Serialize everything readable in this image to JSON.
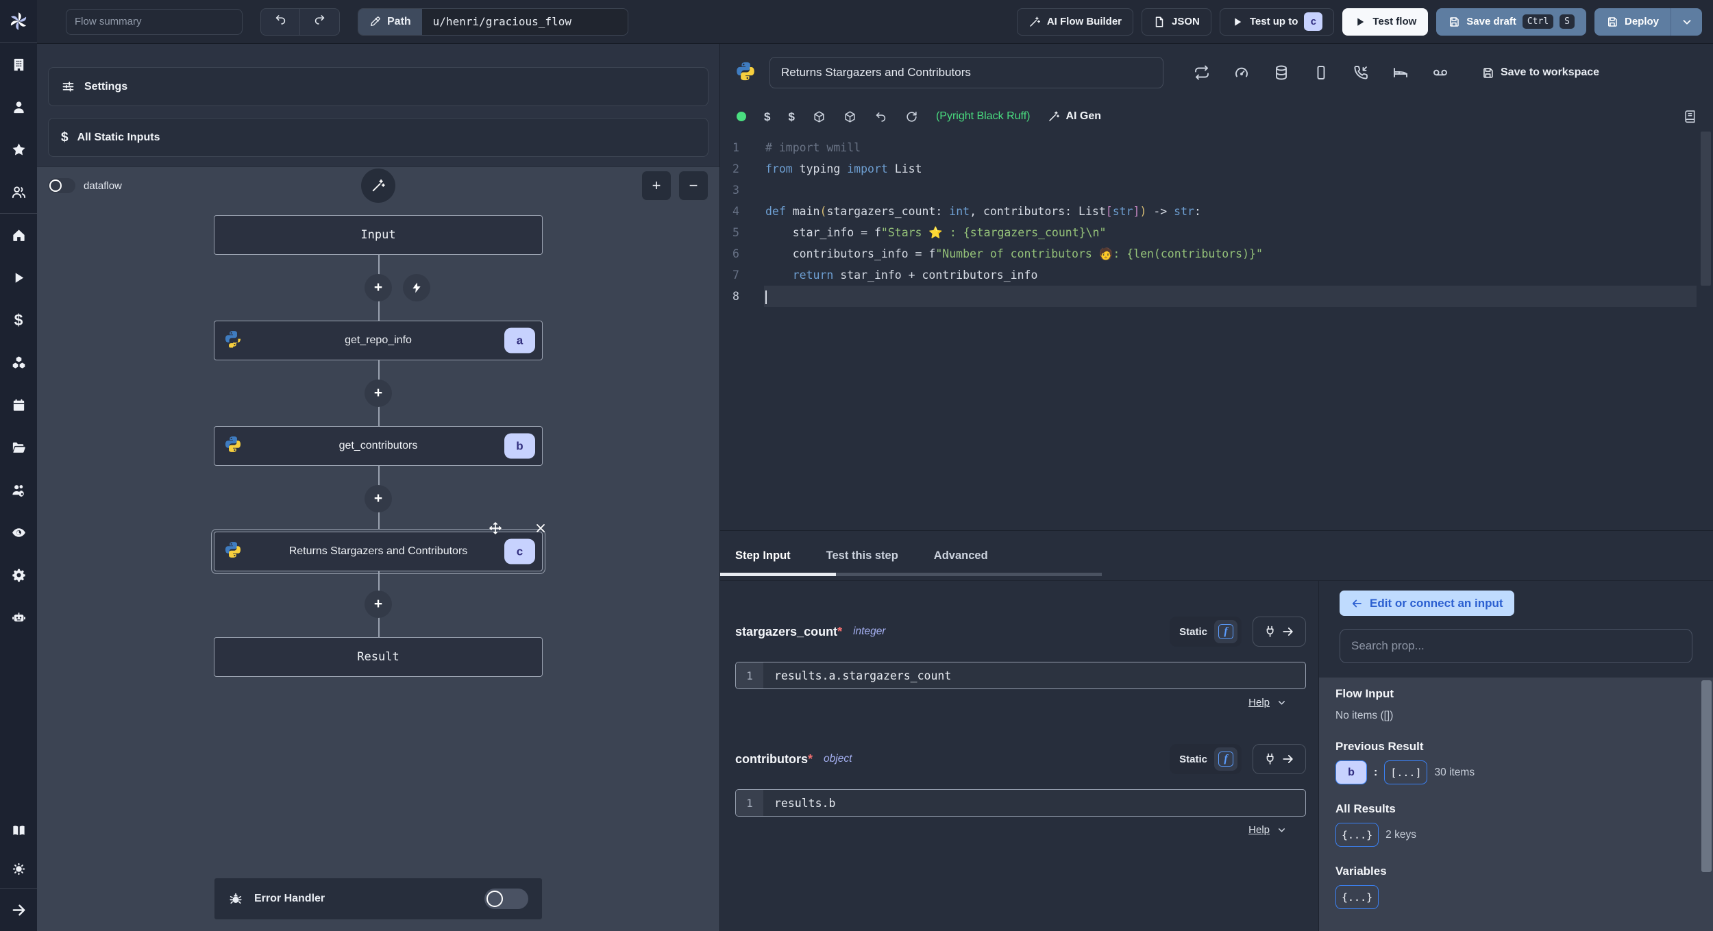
{
  "topbar": {
    "flow_summary_placeholder": "Flow summary",
    "path_label": "Path",
    "path_value": "u/henri/gracious_flow",
    "ai_flow_builder": "AI Flow Builder",
    "json_button": "JSON",
    "test_up_to": "Test up to",
    "test_up_to_badge": "c",
    "test_flow": "Test flow",
    "save_draft": "Save draft",
    "save_draft_keys": [
      "Ctrl",
      "S"
    ],
    "deploy": "Deploy"
  },
  "sidebar": {
    "icons": [
      "windmill-logo",
      "building",
      "user",
      "star",
      "users",
      "home",
      "play",
      "dollar",
      "boxes",
      "calendar",
      "folder-open",
      "users-cog",
      "eye",
      "gear",
      "robot",
      "book",
      "sun-theme",
      "arrow-right"
    ]
  },
  "flow_panel": {
    "settings": "Settings",
    "all_static_inputs": "All Static Inputs",
    "dataflow_label": "dataflow",
    "graph": {
      "input_node": "Input",
      "steps": [
        {
          "label": "get_repo_info",
          "badge": "a",
          "language": "python"
        },
        {
          "label": "get_contributors",
          "badge": "b",
          "language": "python"
        },
        {
          "label": "Returns Stargazers and Contributors",
          "badge": "c",
          "language": "python",
          "selected": true
        }
      ],
      "result_node": "Result"
    },
    "error_handler": "Error Handler",
    "error_handler_enabled": false
  },
  "editor": {
    "title": "Returns Stargazers and Contributors",
    "save_to_workspace": "Save to workspace",
    "header_icons": [
      "repeat",
      "gauge",
      "database",
      "rectangle",
      "phone-incoming",
      "bed",
      "voicemail"
    ],
    "toolbar_icons": [
      "status-dot-green",
      "dollar",
      "dollar",
      "package",
      "package",
      "undo",
      "refresh"
    ],
    "lint_status": "(Pyright Black Ruff)",
    "ai_gen": "AI Gen",
    "right_icon": "book",
    "code": {
      "active_line": 8,
      "plain": "# import wmill\nfrom typing import List\n\ndef main(stargazers_count: int, contributors: List[str]) -> str:\n    star_info = f\"Stars ⭐ : {stargazers_count}\\n\"\n    contributors_info = f\"Number of contributors 🧑: {len(contributors)}\"\n    return star_info + contributors_info\n",
      "lines": [
        [
          {
            "t": "# import wmill",
            "c": "cm"
          }
        ],
        [
          {
            "t": "from ",
            "c": "kw"
          },
          {
            "t": "typing ",
            "c": "id"
          },
          {
            "t": "import ",
            "c": "kw"
          },
          {
            "t": "List",
            "c": "id"
          }
        ],
        [],
        [
          {
            "t": "def ",
            "c": "kw"
          },
          {
            "t": "main",
            "c": "id"
          },
          {
            "t": "(",
            "c": "pr"
          },
          {
            "t": "stargazers_count",
            "c": "id"
          },
          {
            "t": ": ",
            "c": "id"
          },
          {
            "t": "int",
            "c": "kw"
          },
          {
            "t": ", ",
            "c": "id"
          },
          {
            "t": "contributors",
            "c": "id"
          },
          {
            "t": ": ",
            "c": "id"
          },
          {
            "t": "List",
            "c": "id"
          },
          {
            "t": "[",
            "c": "br"
          },
          {
            "t": "str",
            "c": "kw"
          },
          {
            "t": "]",
            "c": "br"
          },
          {
            "t": ")",
            "c": "pr"
          },
          {
            "t": " -> ",
            "c": "id"
          },
          {
            "t": "str",
            "c": "kw"
          },
          {
            "t": ":",
            "c": "id"
          }
        ],
        [
          {
            "t": "    star_info",
            "c": "id"
          },
          {
            "t": " = f",
            "c": "id"
          },
          {
            "t": "\"Stars ⭐ : {stargazers_count}\\n\"",
            "c": "str"
          }
        ],
        [
          {
            "t": "    contributors_info",
            "c": "id"
          },
          {
            "t": " = f",
            "c": "id"
          },
          {
            "t": "\"Number of contributors 🧑: {len(contributors)}\"",
            "c": "str"
          }
        ],
        [
          {
            "t": "    ",
            "c": "id"
          },
          {
            "t": "return ",
            "c": "kw"
          },
          {
            "t": "star_info + contributors_info",
            "c": "id"
          }
        ],
        []
      ]
    }
  },
  "step_panel": {
    "tabs": [
      "Step Input",
      "Test this step",
      "Advanced"
    ],
    "active_tab": "Step Input",
    "fields": [
      {
        "name": "stargazers_count",
        "required": "*",
        "type": "integer",
        "mode": "Static",
        "line_no": "1",
        "expr": "results.a.stargazers_count",
        "help": "Help"
      },
      {
        "name": "contributors",
        "required": "*",
        "type": "object",
        "mode": "Static",
        "line_no": "1",
        "expr": "results.b",
        "help": "Help"
      }
    ]
  },
  "connect_panel": {
    "edit_button": "Edit or connect an input",
    "search_placeholder": "Search prop...",
    "flow_input_title": "Flow Input",
    "flow_input_empty": "No items ([])",
    "previous_result_title": "Previous Result",
    "previous_result_key": "b",
    "previous_result_colon": ":",
    "previous_result_collapsed": "[...]",
    "previous_result_meta": "30 items",
    "all_results_title": "All Results",
    "all_results_collapsed": "{...}",
    "all_results_meta": "2 keys",
    "variables_title": "Variables",
    "variables_collapsed": "{...}"
  },
  "colors": {
    "accent_steel_blue": "#5e7da1",
    "badge_lavender": "#c7d2fe",
    "badge_text_indigo": "#312e81",
    "edit_button_blue_bg": "#bfdbfe",
    "edit_button_blue_text": "#2b5fd0",
    "lint_green": "#4ade80",
    "graph_bg": "#3c4453",
    "panel_bg": "#2c3342",
    "editor_bg": "#272e3c",
    "sidebar_bg": "#1c2230"
  }
}
